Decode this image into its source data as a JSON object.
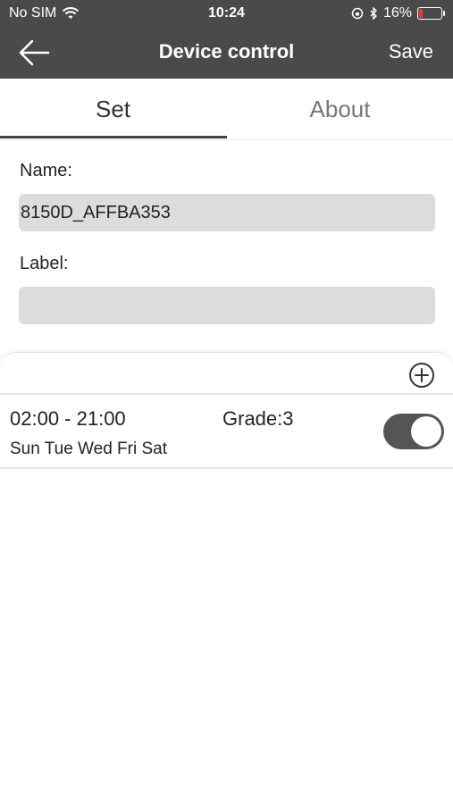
{
  "status_bar": {
    "carrier": "No SIM",
    "time": "10:24",
    "battery": "16%"
  },
  "nav": {
    "title": "Device control",
    "save_label": "Save"
  },
  "tabs": [
    {
      "label": "Set",
      "active": true
    },
    {
      "label": "About",
      "active": false
    }
  ],
  "form": {
    "name_label": "Name:",
    "name_value": "8150D_AFFBA353",
    "label_label": "Label:",
    "label_value": ""
  },
  "schedules": [
    {
      "time_range": "02:00 - 21:00",
      "grade": "Grade:3",
      "days": "Sun Tue Wed Fri Sat",
      "enabled": true
    }
  ],
  "colors": {
    "header_bg": "#4a4a4a",
    "input_bg": "#dcdcdc",
    "toggle_on": "#555555",
    "battery_low": "#e53935"
  },
  "icons": {
    "back": "arrow-left-icon",
    "wifi": "wifi-icon",
    "lock_rotation": "rotation-lock-icon",
    "bluetooth": "bluetooth-icon",
    "battery": "battery-icon",
    "add": "plus-circle-icon"
  }
}
